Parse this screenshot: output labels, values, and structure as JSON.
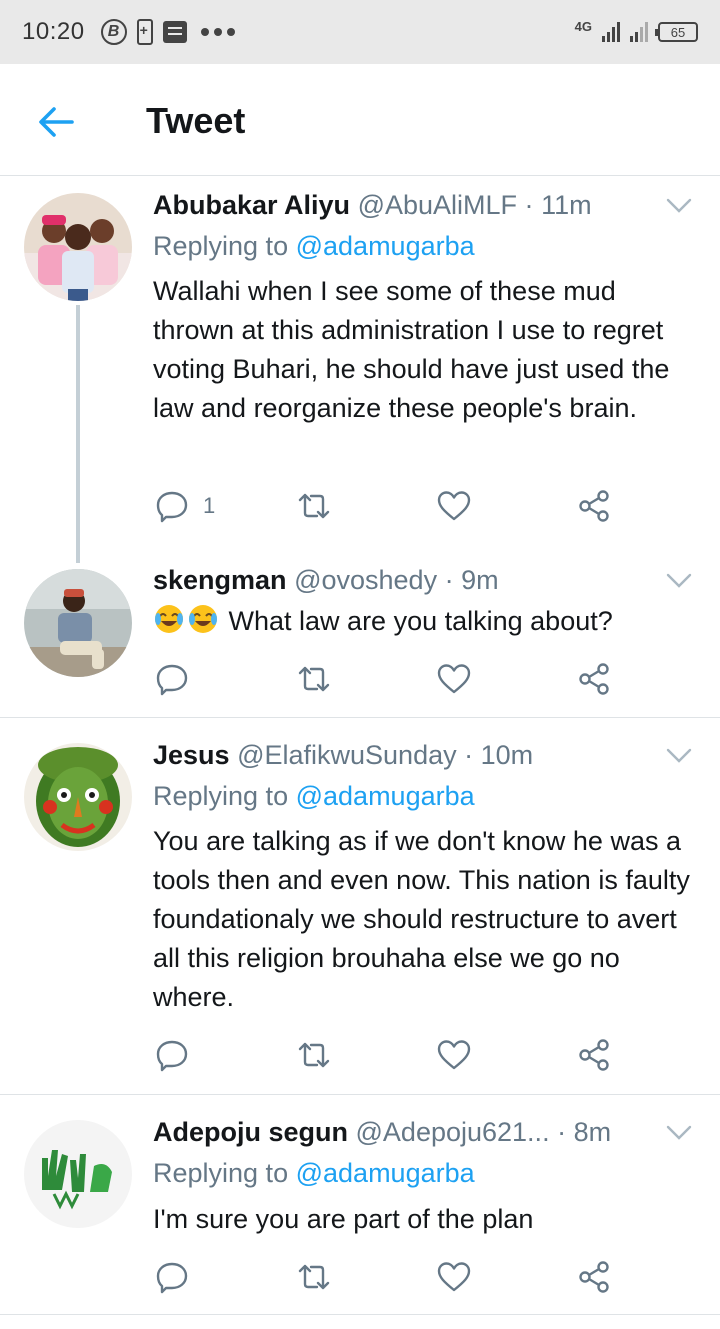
{
  "status_bar": {
    "time": "10:20",
    "network": "4G",
    "battery": "65"
  },
  "header": {
    "title": "Tweet",
    "back_icon": "arrow-left-icon",
    "accent_color": "#1da1f2"
  },
  "tweets": [
    {
      "name": "Abubakar Aliyu",
      "handle": "@AbuAliMLF",
      "dot": "·",
      "time": "11m",
      "replying_prefix": "Replying to",
      "replying_to": "@adamugarba",
      "text": "Wallahi when I see some of these mud thrown at this administration I use to regret voting Buhari, he should have just used the law and reorganize these people's brain.",
      "reply_count": "1"
    },
    {
      "name": "skengman",
      "handle": "@ovoshedy",
      "dot": "·",
      "time": "9m",
      "text": "What law are you talking about?",
      "emoji": "😂😂"
    },
    {
      "name": "Jesus",
      "handle": "@ElafikwuSunday",
      "dot": "·",
      "time": "10m",
      "replying_prefix": "Replying to",
      "replying_to": "@adamugarba",
      "text": "You are talking as if we don't know he was a tools then and even now. This nation is faulty foundationaly we should restructure to avert all this religion brouhaha else we go no where."
    },
    {
      "name": "Adepoju segun",
      "handle": "@Adepoju621...",
      "dot": "·",
      "time": "8m",
      "replying_prefix": "Replying to",
      "replying_to": "@adamugarba",
      "text": "I'm sure you are part of the plan"
    }
  ]
}
